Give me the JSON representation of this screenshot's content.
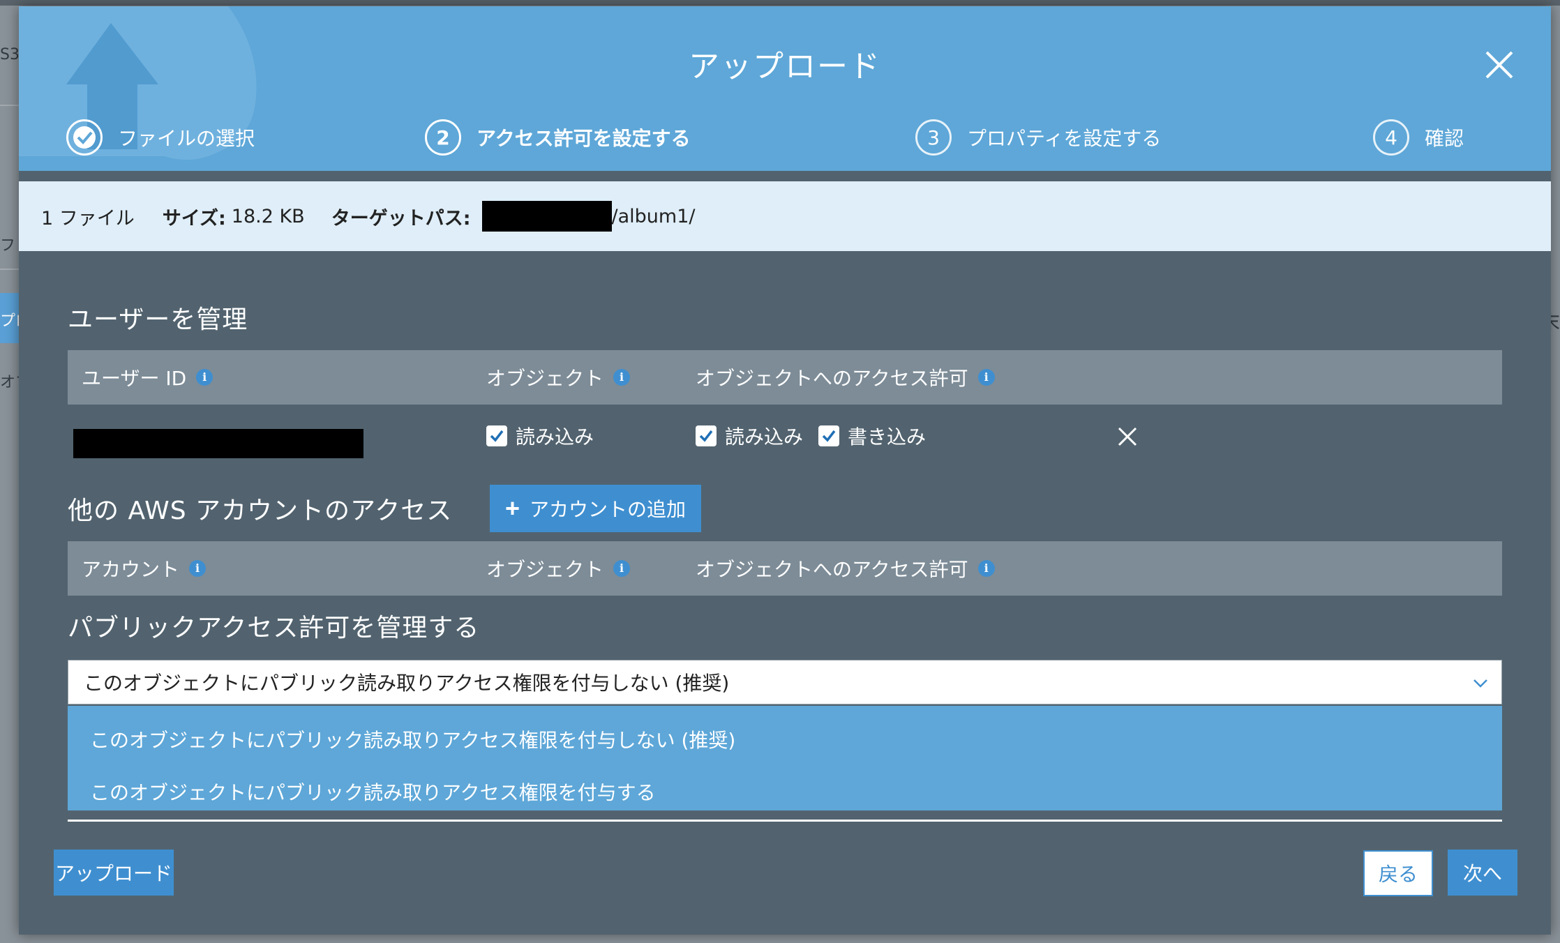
{
  "modal": {
    "title": "アップロード",
    "steps": [
      {
        "number": "✓",
        "label": "ファイルの選択",
        "state": "done"
      },
      {
        "number": "2",
        "label": "アクセス許可を設定する",
        "state": "active"
      },
      {
        "number": "3",
        "label": "プロパティを設定する",
        "state": "pending"
      },
      {
        "number": "4",
        "label": "確認",
        "state": "pending"
      }
    ]
  },
  "summary": {
    "count": "1 ファイル",
    "size_label": "サイズ:",
    "size_value": "18.2 KB",
    "path_label": "ターゲットパス:",
    "path_suffix": "/album1/"
  },
  "users": {
    "title": "ユーザーを管理",
    "col_user_id": "ユーザー ID",
    "col_object": "オブジェクト",
    "col_object_permissions": "オブジェクトへのアクセス許可",
    "row": {
      "object_read": "読み込み",
      "perm_read": "読み込み",
      "perm_write": "書き込み"
    }
  },
  "other_accounts": {
    "title": "他の AWS アカウントのアクセス",
    "add_button": "アカウントの追加",
    "col_account": "アカウント",
    "col_object": "オブジェクト",
    "col_object_permissions": "オブジェクトへのアクセス許可"
  },
  "public_access": {
    "title": "パブリックアクセス許可を管理する",
    "selected": "このオブジェクトにパブリック読み取りアクセス権限を付与しない (推奨)",
    "options": [
      "このオブジェクトにパブリック読み取りアクセス権限を付与しない (推奨)",
      "このオブジェクトにパブリック読み取りアクセス権限を付与する"
    ]
  },
  "footer": {
    "upload": "アップロード",
    "back": "戻る",
    "next": "次へ"
  },
  "background": {
    "left_top": "S3",
    "left_mid": "フ",
    "left_tab": "プロ",
    "left_low": "オブ",
    "right": "末"
  },
  "colors": {
    "header": "#5ea7d8",
    "modal_body": "#52636f",
    "table_head": "#7d8c97",
    "primary_button": "#3f8fd0",
    "summary_bar": "#dfeef8"
  }
}
